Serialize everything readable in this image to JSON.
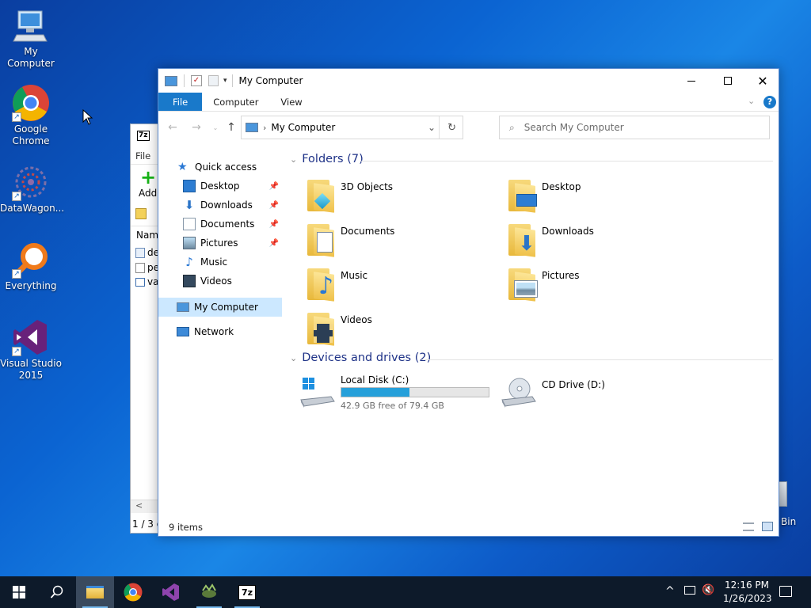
{
  "desktop": {
    "icons": [
      {
        "label": "My Computer"
      },
      {
        "label": "Google Chrome"
      },
      {
        "label": "DataWagon..."
      },
      {
        "label": "Everything"
      },
      {
        "label": "Visual Studio 2015"
      },
      {
        "label": "Bin"
      }
    ]
  },
  "sevenzip_window": {
    "title_icon": "7z",
    "menu_file": "File",
    "toolbar_add": "Add",
    "col_name": "Nam",
    "rows": [
      "de",
      "pe",
      "va"
    ],
    "status": "1 / 3 o"
  },
  "explorer": {
    "title": "My Computer",
    "ribbon_tabs": [
      "File",
      "Computer",
      "View"
    ],
    "address": "My Computer",
    "search_placeholder": "Search My Computer",
    "nav": {
      "quick_access": "Quick access",
      "items": [
        "Desktop",
        "Downloads",
        "Documents",
        "Pictures",
        "Music",
        "Videos"
      ],
      "my_computer": "My Computer",
      "network": "Network"
    },
    "folders_header": "Folders (7)",
    "folders": [
      "3D Objects",
      "Desktop",
      "Documents",
      "Downloads",
      "Music",
      "Pictures",
      "Videos"
    ],
    "drives_header": "Devices and drives (2)",
    "drives": [
      {
        "name": "Local Disk (C:)",
        "free": "42.9 GB free of 79.4 GB",
        "used_fraction": 0.46
      },
      {
        "name": "CD Drive (D:)"
      }
    ],
    "status_items": "9 items"
  },
  "taskbar": {
    "time": "12:16 PM",
    "date": "1/26/2023",
    "apps": [
      "file-explorer",
      "chrome",
      "visual-studio",
      "datawagon",
      "7zip"
    ],
    "sevenzip_label": "7z"
  },
  "colors": {
    "accent": "#1979ca",
    "section_text": "#1e3287",
    "taskbar": "#0d1a2a",
    "selected_nav": "#cce8ff"
  }
}
